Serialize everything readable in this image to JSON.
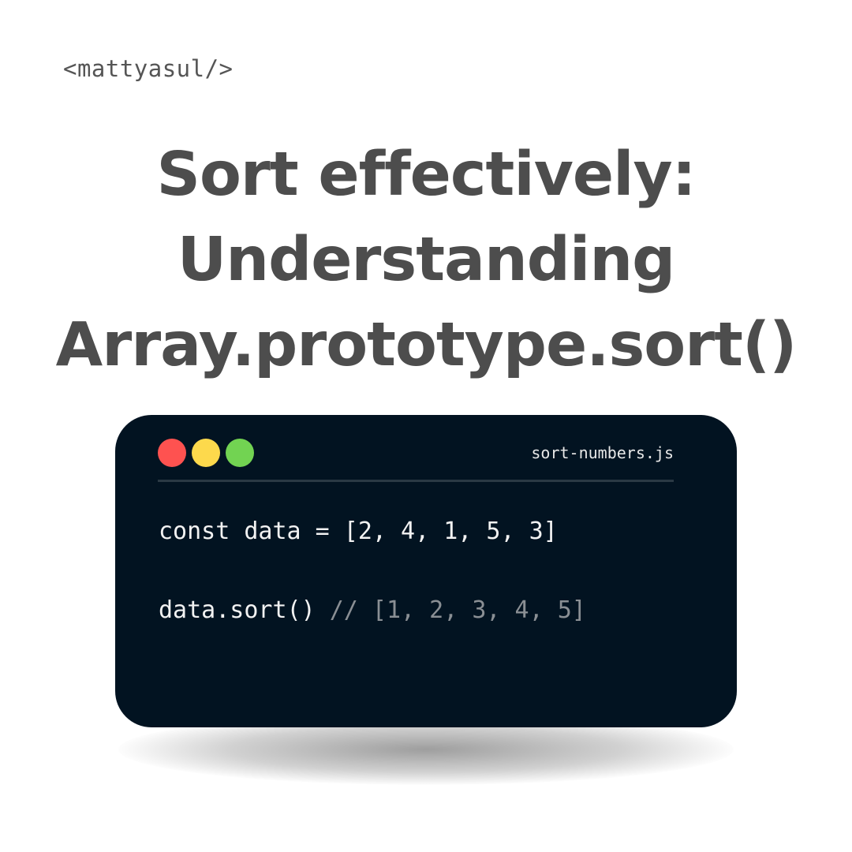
{
  "brand": {
    "label": "<mattyasul/>"
  },
  "headline": {
    "line1": "Sort effectively:",
    "line2": "Understanding",
    "line3": "Array.prototype.sort()"
  },
  "code_window": {
    "filename": "sort-numbers.js",
    "dots": [
      {
        "name": "close",
        "color": "#fe5250"
      },
      {
        "name": "minimize",
        "color": "#fdd94c"
      },
      {
        "name": "maximize",
        "color": "#72d352"
      }
    ],
    "background": "#021321",
    "lines": [
      {
        "code": "const data = [2, 4, 1, 5, 3]",
        "comment": ""
      },
      {
        "code": "data.sort() ",
        "comment": "// [1, 2, 3, 4, 5]"
      }
    ]
  }
}
